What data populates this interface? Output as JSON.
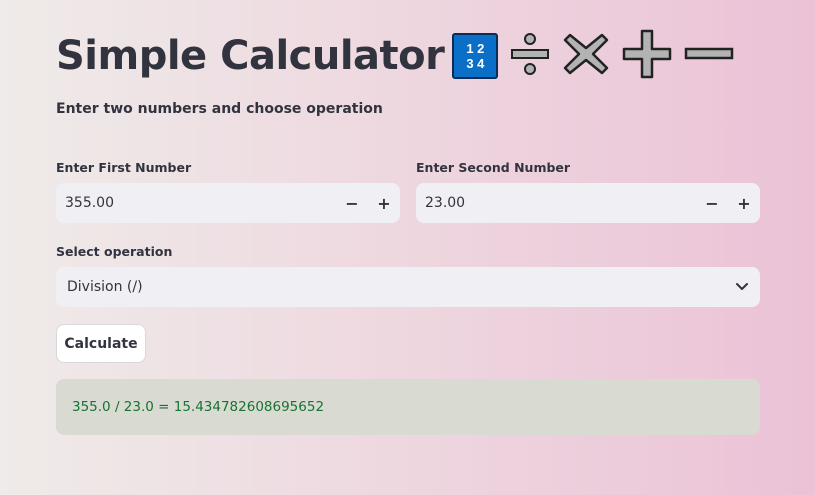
{
  "header": {
    "title": "Simple Calculator",
    "emoji_digits_top": "1 2",
    "emoji_digits_bottom": "3 4",
    "emoji_icons": [
      "input-numbers-icon",
      "divide-icon",
      "multiply-icon",
      "plus-icon",
      "minus-icon"
    ]
  },
  "subtitle": "Enter two numbers and choose operation",
  "first_number": {
    "label": "Enter First Number",
    "value": "355.00",
    "decrement": "−",
    "increment": "+"
  },
  "second_number": {
    "label": "Enter Second Number",
    "value": "23.00",
    "decrement": "−",
    "increment": "+"
  },
  "operation": {
    "label": "Select operation",
    "selected": "Division (/)"
  },
  "calculate_button": {
    "label": "Calculate"
  },
  "result": {
    "text": "355.0 / 23.0 = 15.434782608695652"
  },
  "colors": {
    "text": "#31333f",
    "input_bg": "#f0f0f4",
    "success_text": "#177233",
    "emoji_blue": "#0b6fc8"
  }
}
